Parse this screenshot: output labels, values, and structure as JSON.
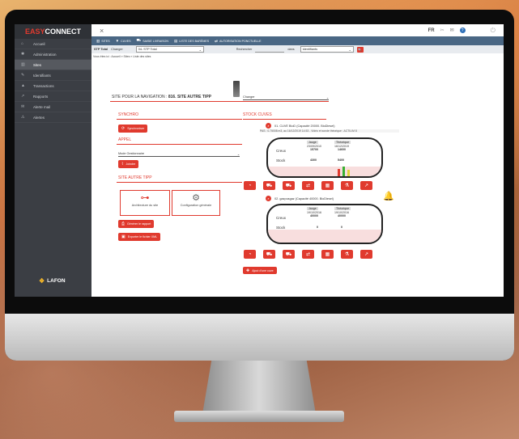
{
  "brand": {
    "easy": "EASY",
    "connect": "CONNECT",
    "footer_logo": "LAFON"
  },
  "nav": [
    {
      "icon": "home-icon",
      "glyph": "⌂",
      "label": "Accueil"
    },
    {
      "icon": "gear-icon",
      "glyph": "✱",
      "label": "Administration"
    },
    {
      "icon": "sites-icon",
      "glyph": "▥",
      "label": "Sites",
      "active": true
    },
    {
      "icon": "wrench-icon",
      "glyph": "✎",
      "label": "Identifiants"
    },
    {
      "icon": "transactions-icon",
      "glyph": "▲",
      "label": "Transactions"
    },
    {
      "icon": "reports-icon",
      "glyph": "↗",
      "label": "Rapports"
    },
    {
      "icon": "mail-icon",
      "glyph": "✉",
      "label": "Alerte mail"
    },
    {
      "icon": "alert-icon",
      "glyph": "⚠",
      "label": "Alertes"
    }
  ],
  "topbar": {
    "close": "×",
    "lang": "FR",
    "help": "?",
    "power": "⏻"
  },
  "menu": [
    {
      "icon": "sites-menu-icon",
      "glyph": "▥",
      "label": "SITES"
    },
    {
      "icon": "filter-icon",
      "glyph": "▼",
      "label": "CUVES"
    },
    {
      "icon": "truck-icon",
      "glyph": "⛟",
      "label": "SAISIE LIVRAISON"
    },
    {
      "icon": "list-icon",
      "glyph": "▤",
      "label": "LISTE DES BARÈMES"
    },
    {
      "icon": "auth-icon",
      "glyph": "⇄",
      "label": "AUTORISATION PONCTUELLE"
    }
  ],
  "filter": {
    "stp_label": "STP Total",
    "change": "Changer",
    "stp_select": "04- STP Total",
    "search_label": "Rechercher",
    "dans": "dans",
    "dans_select": "Identifiants",
    "search_btn": "🔍"
  },
  "breadcrumb": "Vous êtes ici : Accueil » Sites » Liste des sites",
  "site": {
    "title_prefix": "SITE POUR LA NAVIGATION : ",
    "title_name": "816. SITE AUTRE TIPP",
    "change_select": "Changer"
  },
  "synchro": {
    "heading": "SYNCHRO",
    "button": "Synchroniser"
  },
  "appel": {
    "heading": "APPEL",
    "mode": "Mode Gestionnaire",
    "button": "Joindre"
  },
  "site_autre": {
    "heading": "SITE AUTRE TIPP",
    "card1": "Architecture du site",
    "card2": "Configuration générale",
    "report_btn": "Générer le rapport",
    "xml_btn": "Exporter le fichier XML"
  },
  "stock": {
    "heading": "STOCK CUVES",
    "tanks": [
      {
        "title": "01. CUVE BioD (Capacité 20000. BioDiesel)",
        "info": "PAS : 0.75008 m3, au 16/12/2019 14:53 - Vidéo et sonde théorique : ACTILIM 8",
        "col1": "Jauge",
        "col2": "Théorique",
        "date1": "23/09/2010",
        "date2": "16/12/2019",
        "creux": "Creux",
        "creux1": "15700",
        "creux2": "14600",
        "stock": "Stock",
        "stock1": "4300",
        "stock2": "5400",
        "fill": 0.27
      },
      {
        "title": "02. gazpusgaz (Capacité 40000. BioDiesel)",
        "info": "",
        "col1": "Jauge",
        "col2": "Théorique",
        "date1": "19/10/2016",
        "date2": "19/10/2016",
        "creux": "Creux",
        "creux1": "40000",
        "creux2": "40000",
        "stock": "Stock",
        "stock1": "0",
        "stock2": "0",
        "fill": 0.0
      }
    ],
    "add_tank": "Ajout d'une cuve"
  },
  "colors": {
    "accent": "#e03a2e",
    "sidebar": "#3b3e44",
    "menubar": "#4a6784"
  }
}
